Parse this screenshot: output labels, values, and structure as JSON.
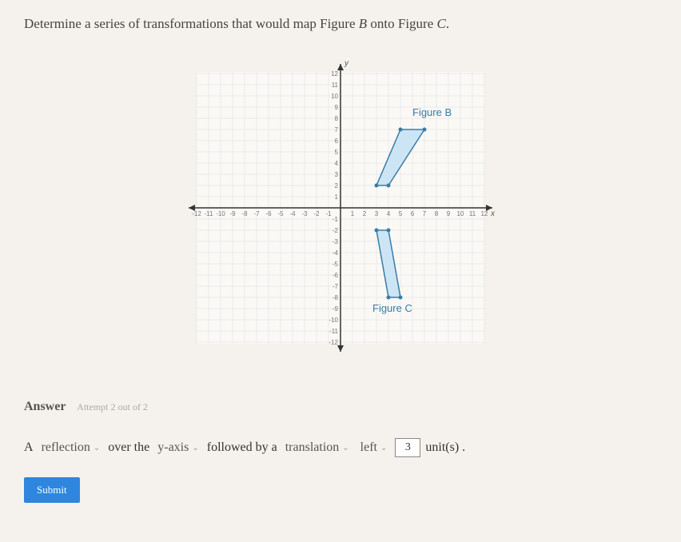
{
  "question": {
    "prefix": "Determine a series of transformations that would map Figure ",
    "figB": "B",
    "mid": " onto Figure ",
    "figC": "C",
    "suffix": "."
  },
  "graph": {
    "y_label": "y",
    "x_label": "x",
    "x_ticks_neg": [
      "-12",
      "-11",
      "-10",
      "-9",
      "-8",
      "-7",
      "-6",
      "-5",
      "-4",
      "-3",
      "-2",
      "-1"
    ],
    "x_ticks_pos": [
      "1",
      "2",
      "3",
      "4",
      "5",
      "6",
      "7",
      "8",
      "9",
      "10",
      "11",
      "12"
    ],
    "y_ticks_pos": [
      "1",
      "2",
      "3",
      "4",
      "5",
      "6",
      "7",
      "8",
      "9",
      "10",
      "11",
      "12"
    ],
    "y_ticks_neg": [
      "-1",
      "-2",
      "-3",
      "-4",
      "-5",
      "-6",
      "-7",
      "-8",
      "-9",
      "-10",
      "-11",
      "-12"
    ],
    "figureB_label": "Figure B",
    "figureC_label": "Figure C",
    "figureB_points": [
      [
        3,
        2
      ],
      [
        4,
        2
      ],
      [
        7,
        7
      ],
      [
        5,
        7
      ]
    ],
    "figureC_points": [
      [
        3,
        -2
      ],
      [
        4,
        -2
      ],
      [
        5,
        -8
      ],
      [
        4,
        -8
      ]
    ]
  },
  "answer": {
    "label": "Answer",
    "attempt": "Attempt 2 out of 2",
    "line": {
      "a": "A",
      "reflection": "reflection",
      "over_the": "over the",
      "axis": "y-axis",
      "followed_by_a": "followed by a",
      "translation": "translation",
      "direction": "left",
      "value": "3",
      "units": "unit(s) ."
    }
  },
  "submit": "Submit"
}
